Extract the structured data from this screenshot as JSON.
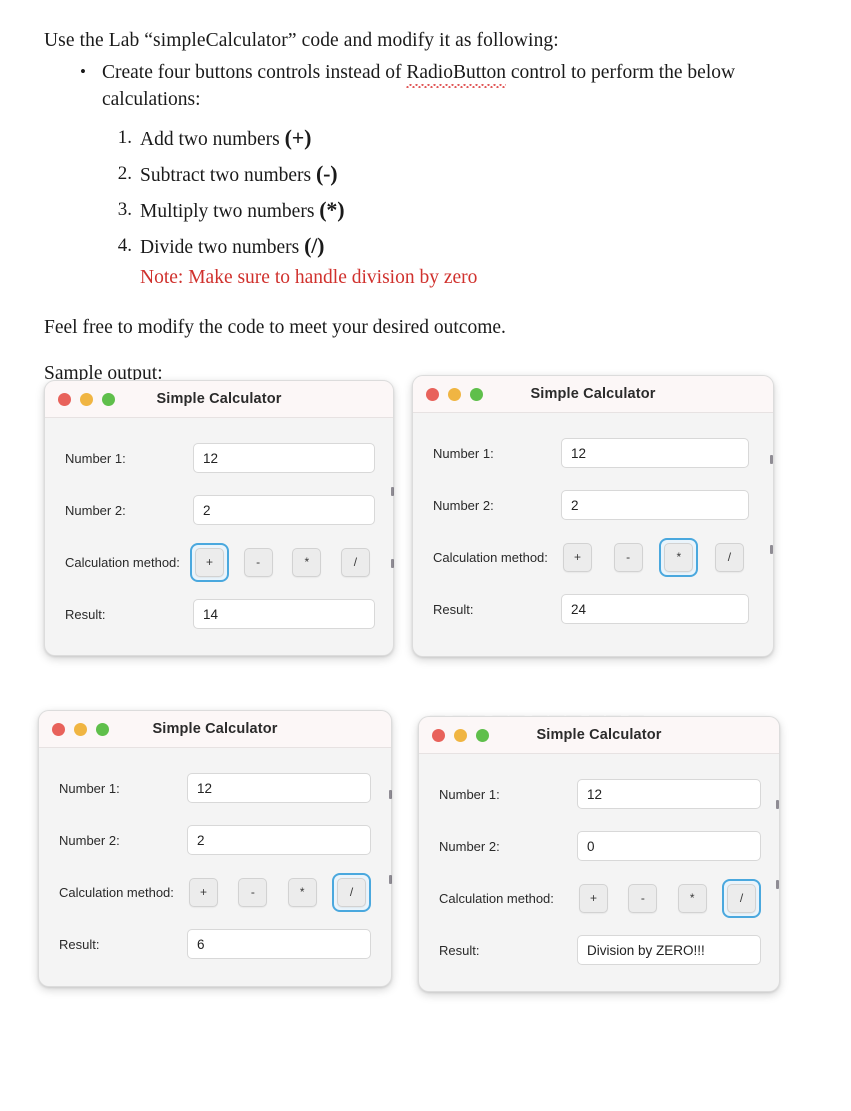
{
  "document": {
    "intro": "Use the Lab “simpleCalculator” code and modify it as following:",
    "bullet": {
      "before": "Create four buttons controls instead of ",
      "misspelled": "RadioButton",
      "after": " control to perform the below calculations:"
    },
    "tasks": [
      {
        "text": "Add two numbers ",
        "operator": "(+)"
      },
      {
        "text": "Subtract two numbers ",
        "operator": "(-)"
      },
      {
        "text": "Multiply two numbers ",
        "operator": "(*)"
      },
      {
        "text": "Divide two numbers ",
        "operator": "(/)"
      }
    ],
    "note": "Note: Make sure to handle division by zero",
    "note_color": "#d0312d",
    "paragraph1": "Feel free to modify the code to meet your desired outcome.",
    "paragraph2": "Sample output:",
    "ghost_text": "—  ——  ——  ———  ——  —"
  },
  "window_chrome": {
    "title": "Simple Calculator",
    "traffic_lights": [
      "close-red",
      "minimize-yellow",
      "maximize-green"
    ],
    "colors": {
      "red": "#e8625b",
      "yellow": "#f0b542",
      "green": "#5fbf4b",
      "focus_ring": "#4aa8de",
      "titlebar_bg": "#fcf7f7",
      "body_bg": "#f4f4f4"
    }
  },
  "labels": {
    "number1": "Number 1:",
    "number2": "Number 2:",
    "method": "Calculation method:",
    "result": "Result:"
  },
  "operators": [
    "+",
    "-",
    "*",
    "/"
  ],
  "windows": [
    {
      "id": "addition",
      "title": "Simple Calculator",
      "number1": "12",
      "number2": "2",
      "selected_operator": "+",
      "selected_index": 0,
      "result": "14"
    },
    {
      "id": "multiplication",
      "title": "Simple Calculator",
      "number1": "12",
      "number2": "2",
      "selected_operator": "*",
      "selected_index": 2,
      "result": "24"
    },
    {
      "id": "division",
      "title": "Simple Calculator",
      "number1": "12",
      "number2": "2",
      "selected_operator": "/",
      "selected_index": 3,
      "result": "6"
    },
    {
      "id": "division-by-zero",
      "title": "Simple Calculator",
      "number1": "12",
      "number2": "0",
      "selected_operator": "/",
      "selected_index": 3,
      "result": "Division by ZERO!!!"
    }
  ]
}
